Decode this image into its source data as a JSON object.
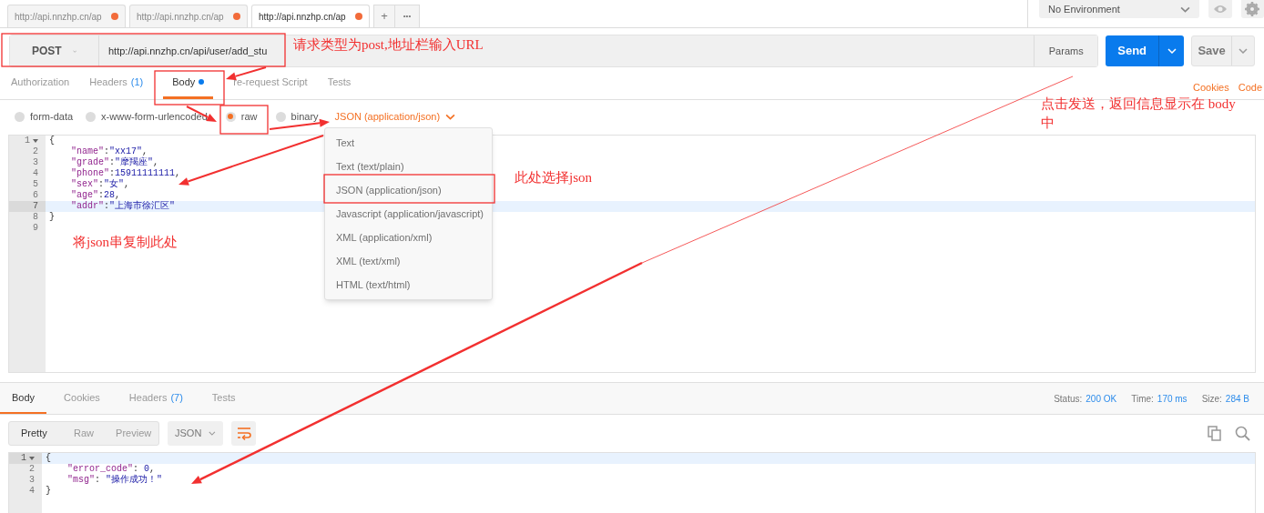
{
  "request_tabs": [
    {
      "title": "http://api.nnzhp.cn/ap",
      "unsaved": true,
      "selected": false
    },
    {
      "title": "http://api.nnzhp.cn/ap",
      "unsaved": true,
      "selected": false
    },
    {
      "title": "http://api.nnzhp.cn/ap",
      "unsaved": true,
      "selected": true
    }
  ],
  "new_tab_button": "+",
  "more_button": "•••",
  "environment": {
    "value": "No Environment"
  },
  "request": {
    "method": "POST",
    "url": "http://api.nnzhp.cn/api/user/add_stu",
    "params_button": "Params",
    "send_button": "Send",
    "save_button": "Save"
  },
  "request_sections": [
    {
      "label": "Authorization",
      "selected": false
    },
    {
      "label": "Headers",
      "count": "(1)",
      "selected": false
    },
    {
      "label": "Body",
      "dot": true,
      "selected": true
    },
    {
      "label": "re-request Script",
      "selected": false
    },
    {
      "label": "Tests",
      "selected": false
    }
  ],
  "links": [
    "Cookies",
    "Code"
  ],
  "body_types": [
    {
      "label": "form-data",
      "selected": false
    },
    {
      "label": "x-www-form-urlencoded",
      "selected": false
    },
    {
      "label": "raw",
      "selected": true
    },
    {
      "label": "binary",
      "selected": false
    }
  ],
  "content_type": {
    "value": "JSON (application/json)"
  },
  "content_type_menu": [
    "Text",
    "Text (text/plain)",
    "JSON (application/json)",
    "Javascript (application/javascript)",
    "XML (application/xml)",
    "XML (text/xml)",
    "HTML (text/html)"
  ],
  "request_body": [
    {
      "number": "1",
      "text": "{",
      "foldable": true,
      "active": false
    },
    {
      "number": "2",
      "text": "    \"name\":\"xx17\",",
      "active": false
    },
    {
      "number": "3",
      "text": "    \"grade\":\"摩羯座\",",
      "active": false
    },
    {
      "number": "4",
      "text": "    \"phone\":15911111111,",
      "active": false
    },
    {
      "number": "5",
      "text": "    \"sex\":\"女\",",
      "active": false
    },
    {
      "number": "6",
      "text": "    \"age\":28,",
      "active": false
    },
    {
      "number": "7",
      "text": "    \"addr\":\"上海市徐汇区\"",
      "active": true
    },
    {
      "number": "8",
      "text": "}",
      "active": false
    },
    {
      "number": "9",
      "active": false
    }
  ],
  "response_sections": [
    {
      "label": "Body",
      "selected": true
    },
    {
      "label": "Cookies",
      "selected": false
    },
    {
      "label": "Headers",
      "count": "(7)",
      "selected": false
    },
    {
      "label": "Tests",
      "selected": false
    }
  ],
  "response_stats": [
    {
      "label": "Status:",
      "value": "200 OK"
    },
    {
      "label": "Time:",
      "value": "170 ms"
    },
    {
      "label": "Size:",
      "value": "284 B"
    }
  ],
  "view_modes": [
    {
      "label": "Pretty",
      "selected": true
    },
    {
      "label": "Raw",
      "selected": false
    },
    {
      "label": "Preview",
      "selected": false
    }
  ],
  "response_format": {
    "value": "JSON"
  },
  "response_body": [
    {
      "number": "1",
      "text": "{",
      "foldable": true,
      "active": true
    },
    {
      "number": "2",
      "text": "    \"error_code\": 0,",
      "active": false
    },
    {
      "number": "3",
      "text": "    \"msg\": \"操作成功！\"",
      "active": false
    },
    {
      "number": "4",
      "text": "}",
      "active": false
    }
  ],
  "annotations": [
    "请求类型为post,地址栏输入URL",
    "此处选择json",
    "将json串复制此处",
    "点击发送，返回信息显示在 body中"
  ]
}
